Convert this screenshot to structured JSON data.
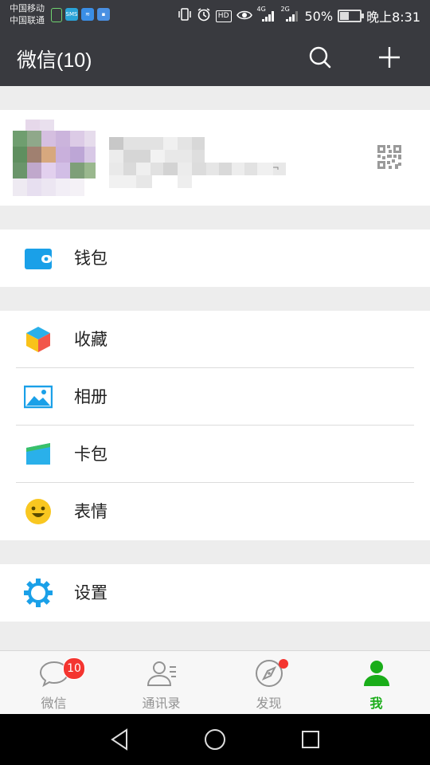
{
  "statusbar": {
    "carrier1": "中国移动",
    "carrier2": "中国联通",
    "net4g": "4G",
    "net2g": "2G",
    "battery_pct": "50%",
    "battery_level": 0.5,
    "time": "晚上8:31",
    "hd": "HD"
  },
  "header": {
    "title": "微信(10)"
  },
  "menu": {
    "wallet": "钱包",
    "favorites": "收藏",
    "album": "相册",
    "cards": "卡包",
    "stickers": "表情",
    "settings": "设置"
  },
  "tabs": [
    {
      "label": "微信",
      "badge": "10"
    },
    {
      "label": "通讯录"
    },
    {
      "label": "发现"
    },
    {
      "label": "我"
    }
  ],
  "colors": {
    "accent": "#1aad19",
    "header_bg": "#393a3f",
    "badge": "#f43530",
    "icon_blue": "#1aa0e8"
  }
}
